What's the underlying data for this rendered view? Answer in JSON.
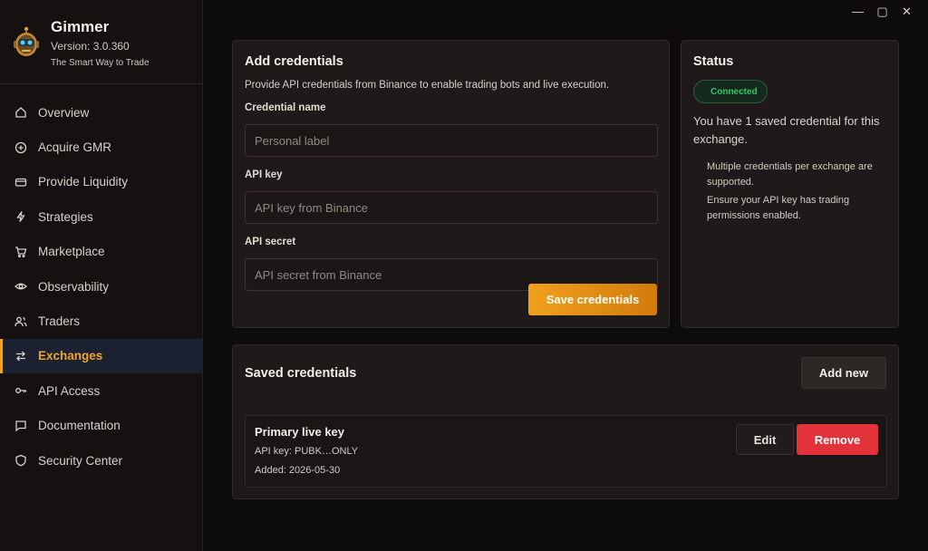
{
  "window": {
    "minimize": "—",
    "maximize": "▢",
    "close": "✕"
  },
  "brand": {
    "app_name": "Gimmer",
    "version": "Version: 3.0.360",
    "tagline": "The Smart Way to Trade",
    "logo_icon": "robot-logo-icon"
  },
  "sidebar": {
    "items": [
      {
        "label": "Overview",
        "icon": "home-icon"
      },
      {
        "label": "Acquire GMR",
        "icon": "plus-circle-icon"
      },
      {
        "label": "Provide Liquidity",
        "icon": "wallet-icon"
      },
      {
        "label": "Strategies",
        "icon": "lightning-icon"
      },
      {
        "label": "Marketplace",
        "icon": "cart-icon"
      },
      {
        "label": "Observability",
        "icon": "eye-icon"
      },
      {
        "label": "Traders",
        "icon": "users-icon"
      },
      {
        "label": "Exchanges",
        "icon": "swap-arrows-icon",
        "active": true
      },
      {
        "label": "API Access",
        "icon": "key-icon"
      },
      {
        "label": "Documentation",
        "icon": "chat-icon"
      },
      {
        "label": "Security Center",
        "icon": "shield-icon"
      }
    ]
  },
  "add_credentials": {
    "title": "Add credentials",
    "description": "Provide API credentials from Binance to enable trading bots and live execution.",
    "credential_name": {
      "label": "Credential name",
      "placeholder": "Personal label",
      "value": ""
    },
    "api_key": {
      "label": "API key",
      "placeholder": "API key from Binance",
      "value": ""
    },
    "api_secret": {
      "label": "API secret",
      "placeholder": "API secret from Binance",
      "value": ""
    },
    "save_label": "Save credentials"
  },
  "status": {
    "title": "Status",
    "badge": "Connected",
    "text": "You have 1 saved credential for this exchange.",
    "notes": [
      "Multiple credentials per exchange are supported.",
      "Ensure your API key has trading permissions enabled."
    ]
  },
  "saved_credentials": {
    "title": "Saved credentials",
    "add_new_label": "Add new",
    "items": [
      {
        "name": "Primary live key",
        "api_key": "API key: PUBK…ONLY",
        "added": "Added: 2026-05-30",
        "edit_label": "Edit",
        "remove_label": "Remove"
      }
    ]
  },
  "colors": {
    "accent": "#f0a522",
    "danger": "#e2333a",
    "success": "#34c36a",
    "background": "#0e0c0b",
    "panel": "#1f1a19"
  }
}
